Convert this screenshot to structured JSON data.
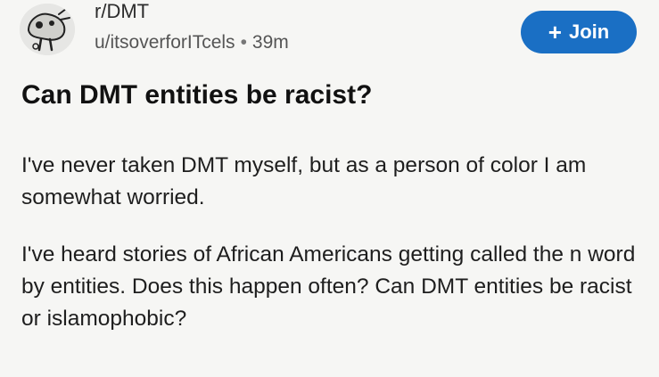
{
  "post": {
    "subreddit": "r/DMT",
    "author": "u/itsoverforITcels",
    "separator": "•",
    "time": "39m",
    "join_label": "Join",
    "join_plus": "+",
    "title": "Can DMT entities be racist?",
    "paragraphs": [
      "I've never taken DMT myself, but as a person of color I am somewhat worried.",
      "I've heard stories of African Americans getting called the n  word by entities. Does this happen often? Can DMT entities be racist or islamophobic?"
    ]
  },
  "icons": {
    "avatar": "subreddit-avatar-icon",
    "plus": "plus-icon"
  },
  "colors": {
    "join_button": "#1a6fc4",
    "background": "#f6f6f4"
  }
}
